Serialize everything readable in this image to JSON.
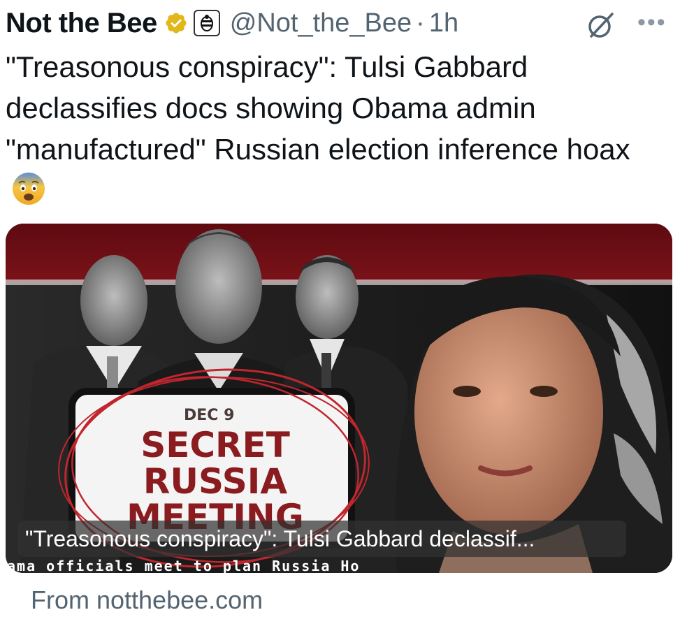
{
  "post": {
    "author_name": "Not the Bee",
    "handle": "@Not_the_Bee",
    "separator": "·",
    "time": "1h",
    "more_label": "•••",
    "text": "\"Treasonous conspiracy\": Tulsi Gabbard declassifies docs showing Obama admin \"manufactured\" Russian election inference hoax"
  },
  "card": {
    "title": "\"Treasonous conspiracy\": Tulsi Gabbard declassif...",
    "ticker_text": "ama officials meet to plan Russia Ho",
    "stamp": {
      "date": "DEC 9",
      "line1": "SECRET",
      "line2": "RUSSIA",
      "line3": "MEETING"
    },
    "source": "From notthebee.com"
  },
  "icons": {
    "verified": "verified-badge-icon",
    "affiliate": "bee-logo-icon",
    "grok": "grok-icon",
    "more": "more-icon",
    "emoji": "fearful-face-emoji"
  },
  "colors": {
    "verified_gold": "#e2b719",
    "muted_text": "#536471",
    "stamp_red": "#c0262d",
    "banner_red": "#6b0d12"
  }
}
